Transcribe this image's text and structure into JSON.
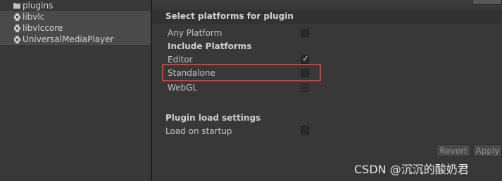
{
  "project_tree": {
    "items": [
      {
        "label": "plugins",
        "icon": "folder-icon",
        "selected": false
      },
      {
        "label": "libvlc",
        "icon": "plugin-file-icon",
        "selected": true
      },
      {
        "label": "libvlccore",
        "icon": "plugin-file-icon",
        "selected": true
      },
      {
        "label": "UniversalMediaPlayer",
        "icon": "plugin-file-icon",
        "selected": true
      }
    ]
  },
  "inspector": {
    "platforms_header": "Select platforms for plugin",
    "any_platform": {
      "label": "Any Platform",
      "checked": false
    },
    "include_platforms_label": "Include Platforms",
    "editor": {
      "label": "Editor",
      "checked": true
    },
    "standalone": {
      "label": "Standalone",
      "checked": false
    },
    "webgl": {
      "label": "WebGL",
      "checked": false
    },
    "load_settings_header": "Plugin load settings",
    "load_on_startup": {
      "label": "Load on startup",
      "checked": false
    },
    "revert_label": "Revert",
    "apply_label": "Apply"
  },
  "watermark": "CSDN @沉沉的酸奶君",
  "colors": {
    "highlight": "#d63a3a",
    "background": "#383838",
    "selected_row": "#4a4a4a"
  }
}
